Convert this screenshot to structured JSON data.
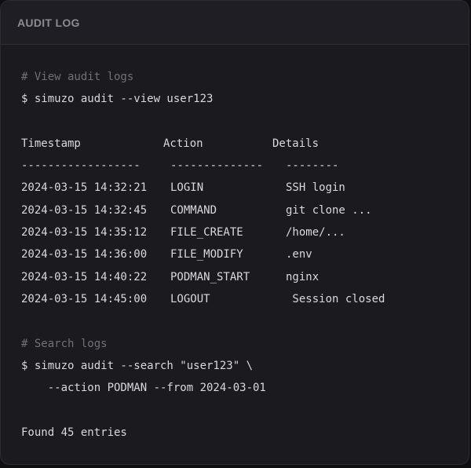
{
  "header": {
    "title": "AUDIT LOG"
  },
  "terminal": {
    "comment_view": "# View audit logs",
    "cmd_view": "$ simuzo audit --view user123",
    "columns": [
      "Timestamp",
      "Action",
      "Details"
    ],
    "separators": [
      "------------------",
      "--------------",
      "--------"
    ],
    "rows": [
      {
        "timestamp": "2024-03-15 14:32:21",
        "action": "LOGIN",
        "details": "SSH login"
      },
      {
        "timestamp": "2024-03-15 14:32:45",
        "action": "COMMAND",
        "details": "git clone ..."
      },
      {
        "timestamp": "2024-03-15 14:35:12",
        "action": "FILE_CREATE",
        "details": "/home/..."
      },
      {
        "timestamp": "2024-03-15 14:36:00",
        "action": "FILE_MODIFY",
        "details": ".env"
      },
      {
        "timestamp": "2024-03-15 14:40:22",
        "action": "PODMAN_START",
        "details": "nginx"
      },
      {
        "timestamp": "2024-03-15 14:45:00",
        "action": "LOGOUT",
        "details": " Session closed"
      }
    ],
    "comment_search": "# Search logs",
    "cmd_search_1": "$ simuzo audit --search \"user123\" \\",
    "cmd_search_2": "    --action PODMAN --from 2024-03-01",
    "result": "Found 45 entries"
  }
}
